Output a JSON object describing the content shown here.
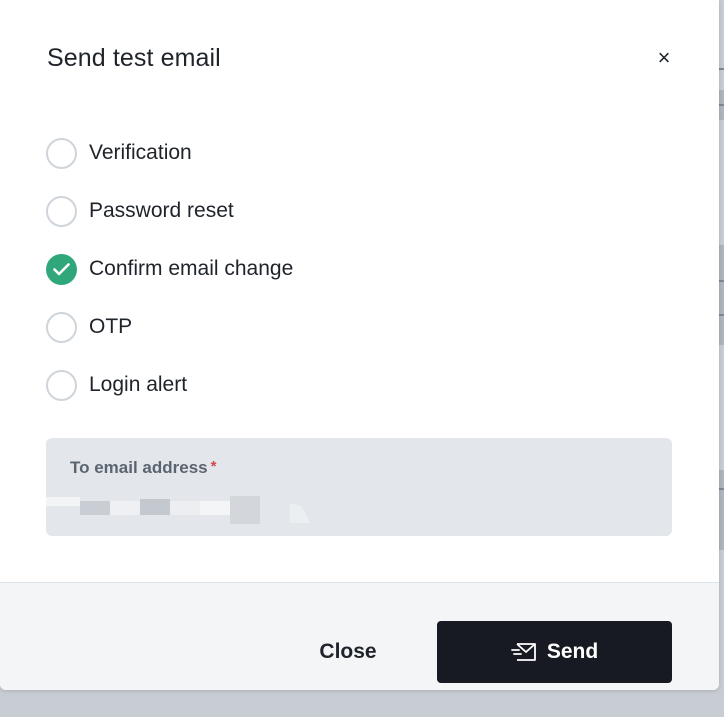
{
  "modal": {
    "title": "Send test email",
    "close_icon": "close-icon",
    "close_glyph": "×"
  },
  "template_options": [
    {
      "label": "Verification",
      "checked": false
    },
    {
      "label": "Password reset",
      "checked": false
    },
    {
      "label": "Confirm email change",
      "checked": true
    },
    {
      "label": "OTP",
      "checked": false
    },
    {
      "label": "Login alert",
      "checked": false
    }
  ],
  "email_field": {
    "label": "To email address",
    "required_marker": "*",
    "value_redacted": true
  },
  "footer": {
    "close_label": "Close",
    "send_label": "Send",
    "send_icon": "envelope-send-icon"
  },
  "colors": {
    "accent_checked": "#2fa77a",
    "primary_button": "#171a23",
    "required": "#d0454c",
    "field_bg": "#e3e7eb"
  }
}
